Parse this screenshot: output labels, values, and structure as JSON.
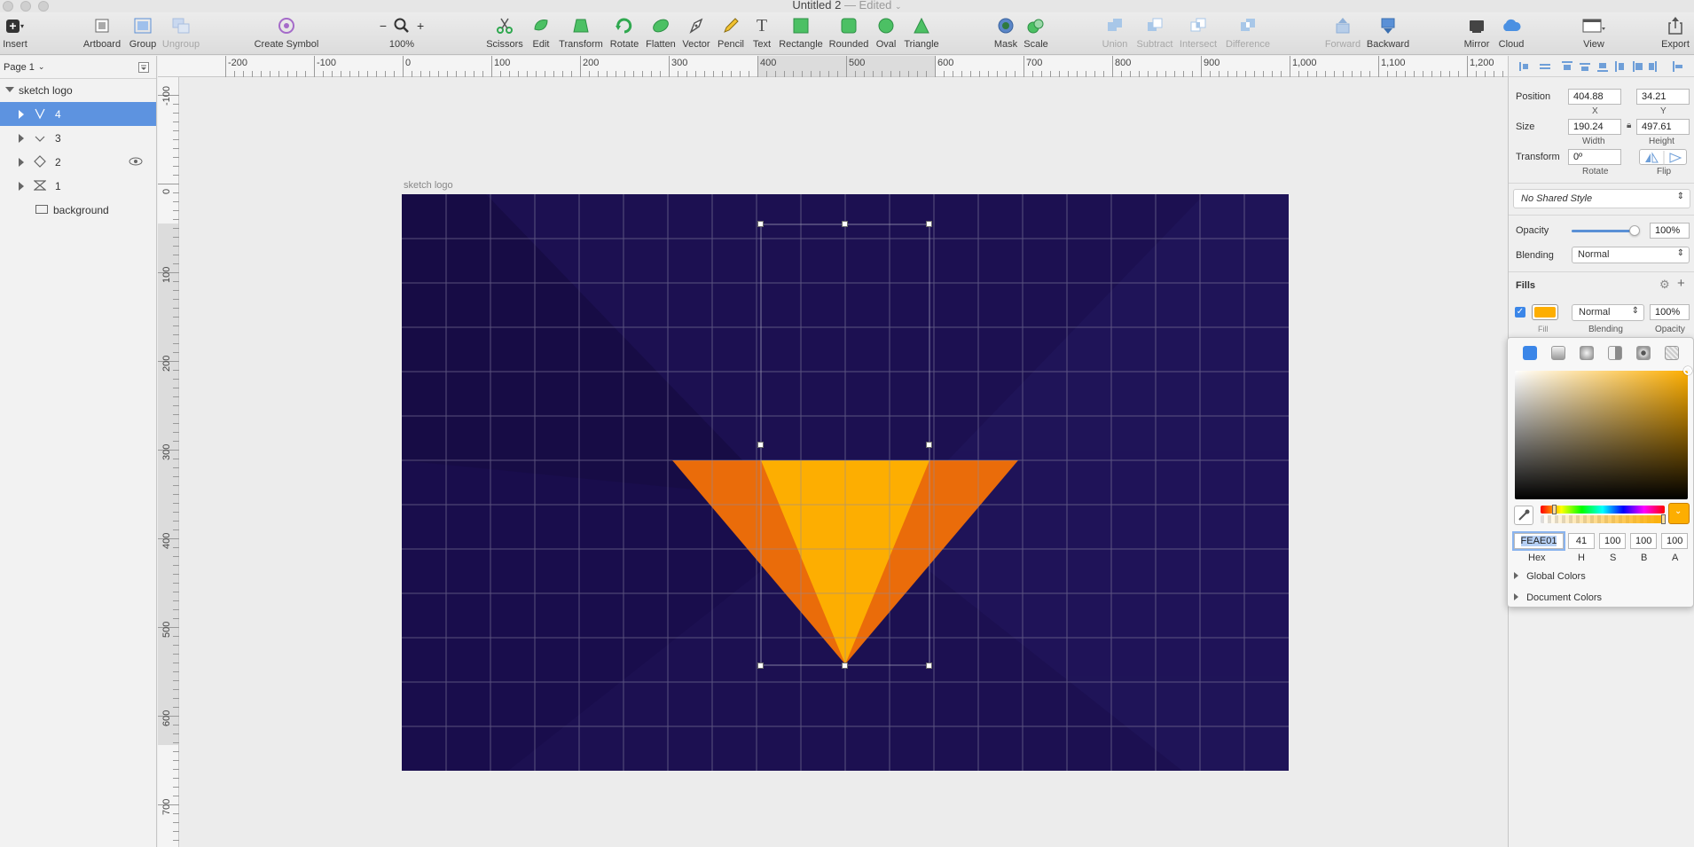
{
  "window": {
    "title": "Untitled 2",
    "edited": "— Edited"
  },
  "toolbar": {
    "insert": "Insert",
    "artboard": "Artboard",
    "group": "Group",
    "ungroup": "Ungroup",
    "create_symbol": "Create Symbol",
    "zoom": "100%",
    "scissors": "Scissors",
    "edit": "Edit",
    "transform": "Transform",
    "rotate": "Rotate",
    "flatten": "Flatten",
    "vector": "Vector",
    "pencil": "Pencil",
    "text": "Text",
    "rectangle": "Rectangle",
    "rounded": "Rounded",
    "oval": "Oval",
    "triangle": "Triangle",
    "mask": "Mask",
    "scale": "Scale",
    "union": "Union",
    "subtract": "Subtract",
    "intersect": "Intersect",
    "difference": "Difference",
    "forward": "Forward",
    "backward": "Backward",
    "mirror": "Mirror",
    "cloud": "Cloud",
    "view": "View",
    "export": "Export",
    "text_glyph": "T",
    "zoom_minus": "−",
    "zoom_plus": "+"
  },
  "pages": {
    "current": "Page 1"
  },
  "layers": [
    {
      "name": "sketch logo"
    },
    {
      "name": "4"
    },
    {
      "name": "3"
    },
    {
      "name": "2"
    },
    {
      "name": "1"
    },
    {
      "name": "background"
    }
  ],
  "ruler": {
    "top": [
      "-200",
      "-100",
      "0",
      "100",
      "200",
      "300",
      "400",
      "500",
      "600",
      "700",
      "800",
      "900",
      "1,000",
      "1,100",
      "1,200"
    ],
    "left": [
      "-100",
      "0",
      "100",
      "200",
      "300",
      "400",
      "500",
      "600",
      "700"
    ]
  },
  "artboard": {
    "name": "sketch logo",
    "background": "#1c1051",
    "grid": "#8e8aa6"
  },
  "shapes": {
    "outer": "#ea6c0a",
    "inner": "#fdae01"
  },
  "inspector": {
    "position_label": "Position",
    "x": "404.88",
    "y": "34.21",
    "x_label": "X",
    "y_label": "Y",
    "size_label": "Size",
    "width": "190.24",
    "height": "497.61",
    "width_label": "Width",
    "height_label": "Height",
    "transform_label": "Transform",
    "rotate": "0º",
    "rotate_label": "Rotate",
    "flip_label": "Flip",
    "shared_style": "No Shared Style",
    "opacity_label": "Opacity",
    "opacity": "100%",
    "blending_label": "Blending",
    "blending": "Normal",
    "fills_label": "Fills",
    "fill_blending": "Normal",
    "fill_opacity": "100%",
    "fill_caption": "Fill",
    "fill_blending_caption": "Blending",
    "fill_opacity_caption": "Opacity",
    "fill_color": "#fdae01",
    "opacity_level": 0.94
  },
  "color_picker": {
    "hex": "FEAE01",
    "h": "41",
    "s": "100",
    "b": "100",
    "a": "100",
    "hex_label": "Hex",
    "h_label": "H",
    "s_label": "S",
    "b_label": "B",
    "a_label": "A",
    "global_colors": "Global Colors",
    "document_colors": "Document Colors",
    "hue_position": 0.11
  }
}
